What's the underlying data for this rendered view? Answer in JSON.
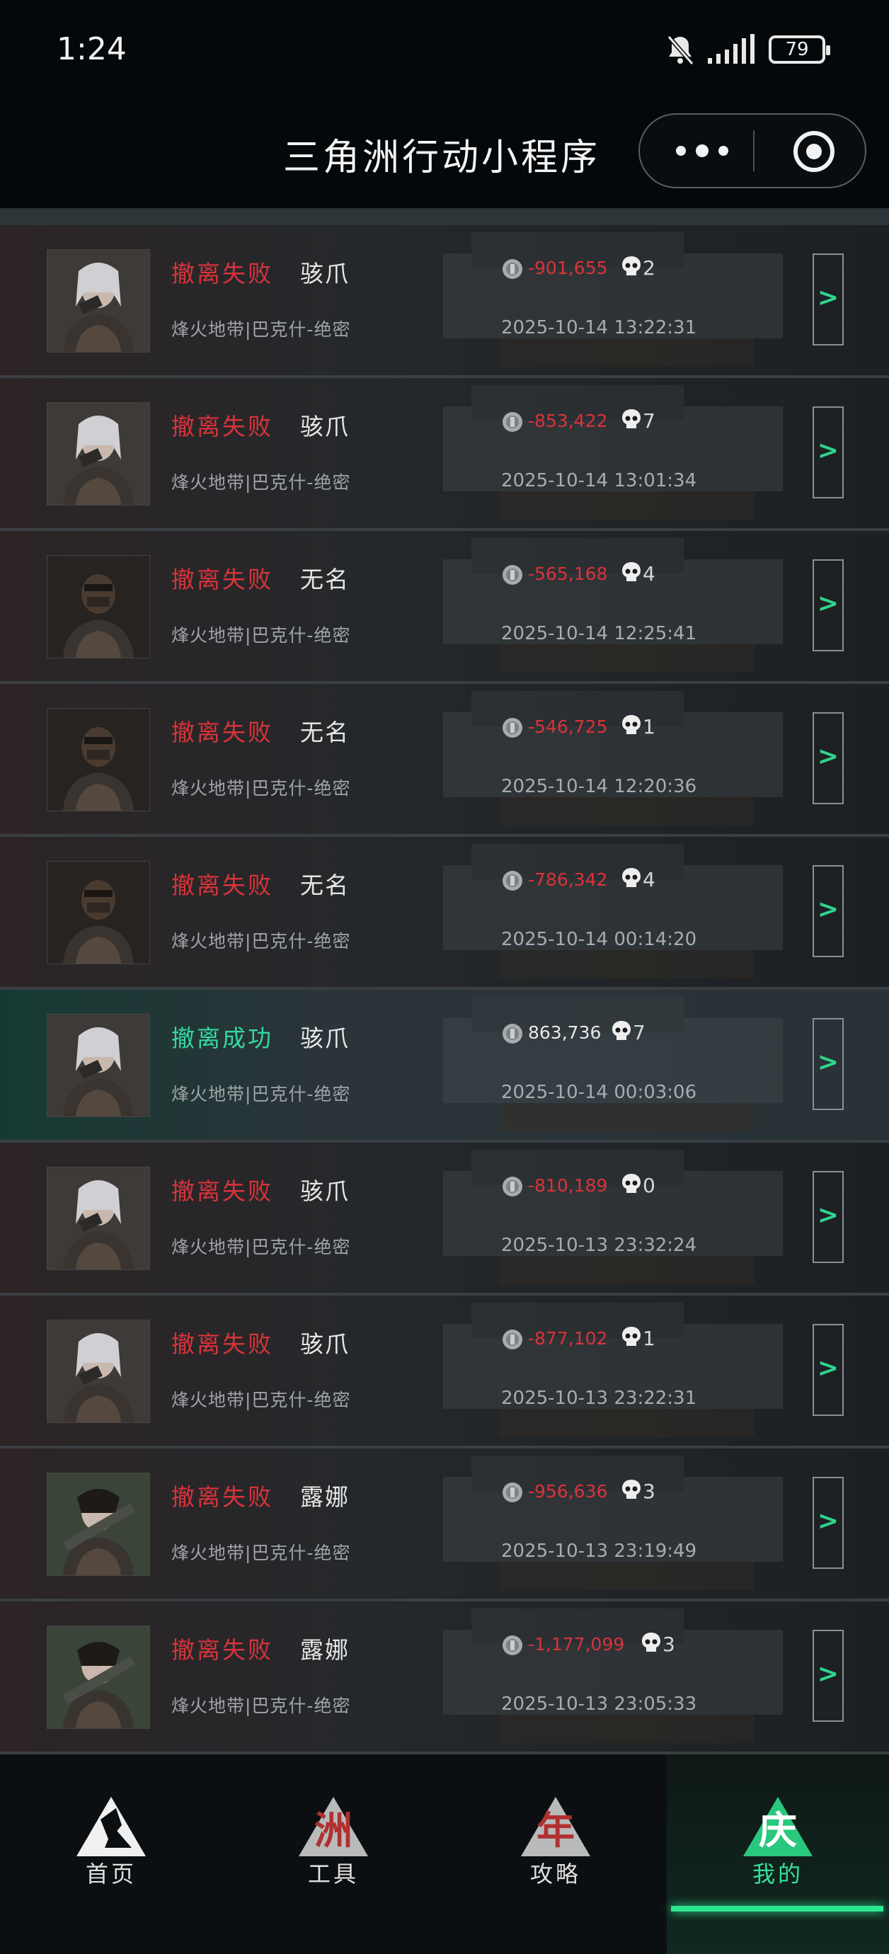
{
  "status_bar": {
    "time": "1:24",
    "battery": "79"
  },
  "header": {
    "title": "三角洲行动小程序"
  },
  "colors": {
    "fail": "#d8333a",
    "success": "#35d7a0",
    "accent": "#2ee68f"
  },
  "records": [
    {
      "status": "撤离失败",
      "result": "fail",
      "operator": "骇爪",
      "map": "烽火地带|巴克什-绝密",
      "value": "-901,655",
      "kills": "2",
      "datetime": "2025-10-14 13:22:31",
      "avatar": "white-hair"
    },
    {
      "status": "撤离失败",
      "result": "fail",
      "operator": "骇爪",
      "map": "烽火地带|巴克什-绝密",
      "value": "-853,422",
      "kills": "7",
      "datetime": "2025-10-14 13:01:34",
      "avatar": "white-hair"
    },
    {
      "status": "撤离失败",
      "result": "fail",
      "operator": "无名",
      "map": "烽火地带|巴克什-绝密",
      "value": "-565,168",
      "kills": "4",
      "datetime": "2025-10-14 12:25:41",
      "avatar": "masked"
    },
    {
      "status": "撤离失败",
      "result": "fail",
      "operator": "无名",
      "map": "烽火地带|巴克什-绝密",
      "value": "-546,725",
      "kills": "1",
      "datetime": "2025-10-14 12:20:36",
      "avatar": "masked"
    },
    {
      "status": "撤离失败",
      "result": "fail",
      "operator": "无名",
      "map": "烽火地带|巴克什-绝密",
      "value": "-786,342",
      "kills": "4",
      "datetime": "2025-10-14 00:14:20",
      "avatar": "masked"
    },
    {
      "status": "撤离成功",
      "result": "success",
      "operator": "骇爪",
      "map": "烽火地带|巴克什-绝密",
      "value": "863,736",
      "kills": "7",
      "datetime": "2025-10-14 00:03:06",
      "avatar": "white-hair"
    },
    {
      "status": "撤离失败",
      "result": "fail",
      "operator": "骇爪",
      "map": "烽火地带|巴克什-绝密",
      "value": "-810,189",
      "kills": "0",
      "datetime": "2025-10-13 23:32:24",
      "avatar": "white-hair"
    },
    {
      "status": "撤离失败",
      "result": "fail",
      "operator": "骇爪",
      "map": "烽火地带|巴克什-绝密",
      "value": "-877,102",
      "kills": "1",
      "datetime": "2025-10-13 23:22:31",
      "avatar": "white-hair"
    },
    {
      "status": "撤离失败",
      "result": "fail",
      "operator": "露娜",
      "map": "烽火地带|巴克什-绝密",
      "value": "-956,636",
      "kills": "3",
      "datetime": "2025-10-13 23:19:49",
      "avatar": "dark-hair"
    },
    {
      "status": "撤离失败",
      "result": "fail",
      "operator": "露娜",
      "map": "烽火地带|巴克什-绝密",
      "value": "-1,177,099",
      "kills": "3",
      "datetime": "2025-10-13 23:05:33",
      "avatar": "dark-hair"
    }
  ],
  "detail_label": ">",
  "nav": [
    {
      "label": "首页",
      "icon": "home-logo-icon",
      "glyph": ""
    },
    {
      "label": "工具",
      "icon": "tools-logo-icon",
      "glyph": "洲"
    },
    {
      "label": "攻略",
      "icon": "guide-logo-icon",
      "glyph": "年"
    },
    {
      "label": "我的",
      "icon": "profile-logo-icon",
      "glyph": "庆",
      "active": true
    }
  ]
}
